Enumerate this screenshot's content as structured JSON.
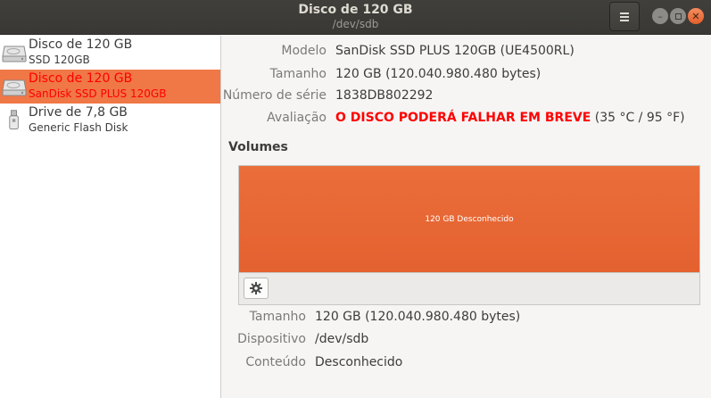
{
  "window": {
    "title": "Disco de 120 GB",
    "subtitle": "/dev/sdb"
  },
  "sidebar": {
    "drives": [
      {
        "name": "Disco de 120 GB",
        "desc": "SSD 120GB",
        "icon": "hard-disk-icon",
        "selected": false
      },
      {
        "name": "Disco de 120 GB",
        "desc": "SanDisk SSD PLUS 120GB",
        "icon": "hard-disk-icon",
        "selected": true
      },
      {
        "name": "Drive de 7,8 GB",
        "desc": "Generic Flash Disk",
        "icon": "usb-drive-icon",
        "selected": false
      }
    ]
  },
  "details": {
    "model_label": "Modelo",
    "model_value": "SanDisk SSD PLUS 120GB (UE4500RL)",
    "size_label": "Tamanho",
    "size_value": "120 GB (120.040.980.480 bytes)",
    "serial_label": "Número de série",
    "serial_value": "1838DB802292",
    "rating_label": "Avaliação",
    "rating_warning": "O DISCO PODERÁ FALHAR EM BREVE",
    "rating_temp": " (35 °C / 95 °F)"
  },
  "volumes": {
    "section_title": "Volumes",
    "partition_label": "120 GB Desconhecido",
    "size_label": "Tamanho",
    "size_value": "120 GB (120.040.980.480 bytes)",
    "device_label": "Dispositivo",
    "device_value": "/dev/sdb",
    "content_label": "Conteúdo",
    "content_value": "Desconhecido"
  },
  "colors": {
    "accent": "#f07746",
    "warning": "#ff0000",
    "volume": "#e86632",
    "titlebar": "#3c3b37"
  }
}
